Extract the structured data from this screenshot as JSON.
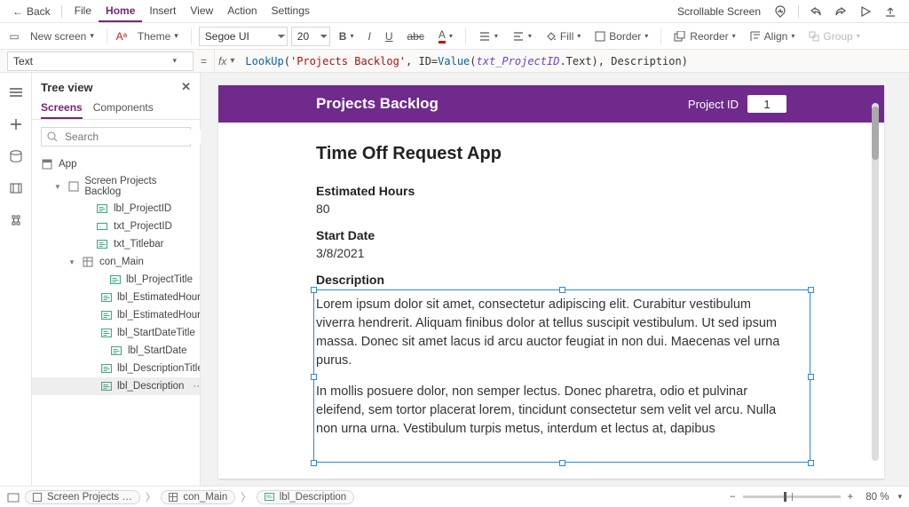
{
  "menu": {
    "back": "Back",
    "items": [
      "File",
      "Home",
      "Insert",
      "View",
      "Action",
      "Settings"
    ],
    "active_index": 1,
    "screen_mode": "Scrollable Screen"
  },
  "ribbon": {
    "new_screen": "New screen",
    "theme": "Theme",
    "font_family": "Segoe UI",
    "font_size": "20",
    "fill": "Fill",
    "border": "Border",
    "reorder": "Reorder",
    "align": "Align",
    "group": "Group"
  },
  "formula": {
    "property": "Text",
    "fx": "fx",
    "fn1": "LookUp",
    "open": "(",
    "str1": "'Projects Backlog'",
    "c1": ", ID=",
    "fn2": "Value",
    "open2": "(",
    "fld": "txt_ProjectID",
    "dot": ".Text)",
    "c2": ", Description)",
    "raw": "LookUp('Projects Backlog', ID=Value(txt_ProjectID.Text), Description)"
  },
  "tree": {
    "title": "Tree view",
    "tabs": [
      "Screens",
      "Components"
    ],
    "active_tab": 0,
    "search_placeholder": "Search",
    "app_label": "App",
    "items": [
      {
        "label": "Screen Projects Backlog",
        "kind": "screen",
        "indent": 1,
        "expand": "down"
      },
      {
        "label": "lbl_ProjectID",
        "kind": "label",
        "indent": 3
      },
      {
        "label": "txt_ProjectID",
        "kind": "input",
        "indent": 3
      },
      {
        "label": "txt_Titlebar",
        "kind": "label",
        "indent": 3
      },
      {
        "label": "con_Main",
        "kind": "container",
        "indent": 2,
        "expand": "down"
      },
      {
        "label": "lbl_ProjectTitle",
        "kind": "label",
        "indent": 4
      },
      {
        "label": "lbl_EstimatedHoursTitle",
        "kind": "label",
        "indent": 4
      },
      {
        "label": "lbl_EstimatedHours",
        "kind": "label",
        "indent": 4
      },
      {
        "label": "lbl_StartDateTitle",
        "kind": "label",
        "indent": 4
      },
      {
        "label": "lbl_StartDate",
        "kind": "label",
        "indent": 4
      },
      {
        "label": "lbl_DescriptionTitle",
        "kind": "label",
        "indent": 4
      },
      {
        "label": "lbl_Description",
        "kind": "label",
        "indent": 4,
        "selected": true
      }
    ]
  },
  "app": {
    "header_title": "Projects Backlog",
    "project_id_label": "Project ID",
    "project_id_value": "1",
    "project_title": "Time Off Request App",
    "est_hours_label": "Estimated Hours",
    "est_hours_value": "80",
    "start_date_label": "Start Date",
    "start_date_value": "3/8/2021",
    "description_label": "Description",
    "description_p1": "Lorem ipsum dolor sit amet, consectetur adipiscing elit. Curabitur vestibulum viverra hendrerit. Aliquam finibus dolor at tellus suscipit vestibulum. Ut sed ipsum massa. Donec sit amet lacus id arcu auctor feugiat in non dui. Maecenas vel urna purus.",
    "description_p2": "In mollis posuere dolor, non semper lectus. Donec pharetra, odio et pulvinar eleifend, sem tortor placerat lorem, tincidunt consectetur sem velit vel arcu. Nulla non urna urna. Vestibulum turpis metus, interdum et lectus at, dapibus"
  },
  "breadcrumbs": {
    "items": [
      "Screen Projects …",
      "con_Main",
      "lbl_Description"
    ]
  },
  "status": {
    "zoom": "80 %"
  }
}
